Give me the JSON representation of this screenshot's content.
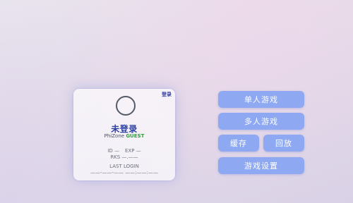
{
  "profile": {
    "login_link": "登录",
    "username": "未登录",
    "brand_name": "PhiZone",
    "status": "GUEST",
    "id_text": "ID —",
    "exp_text": "EXP —",
    "rks_text": "RKS —.——",
    "last_login_label": "LAST LOGIN",
    "last_login_value": "——-——-—— ——:——:——"
  },
  "menu": {
    "single_player": "单人游戏",
    "multi_player": "多人游戏",
    "cache": "缓存",
    "replay": "回放",
    "settings": "游戏设置"
  },
  "colors": {
    "button_bg": "#8ea9f2",
    "accent_blue": "#2c3fa3",
    "guest_green": "#2e9e3e"
  }
}
